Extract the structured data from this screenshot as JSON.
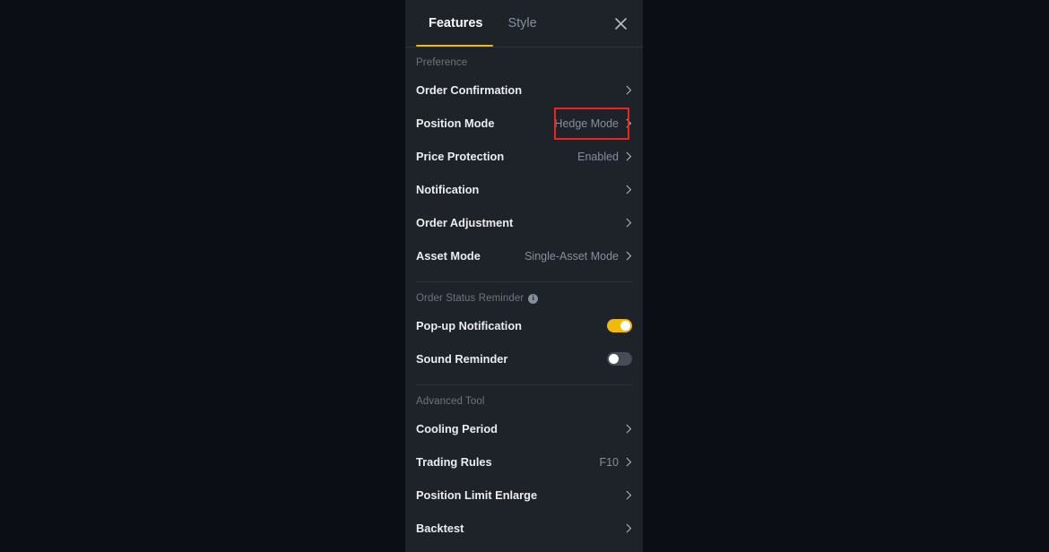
{
  "colors": {
    "page_background": "#0b0e15",
    "panel_background": "#1e2329",
    "accent": "#f0b90b",
    "divider": "#2b3139",
    "label_text": "#eaecef",
    "muted_text": "#848e9c",
    "highlight_box": "#e8271f"
  },
  "header": {
    "tabs": [
      {
        "label": "Features",
        "active": true
      },
      {
        "label": "Style",
        "active": false
      }
    ],
    "close_icon": "close-icon",
    "close_glyph": "✕"
  },
  "sections": [
    {
      "label": "Preference",
      "has_info_icon": false,
      "rows": [
        {
          "label": "Order Confirmation",
          "value": "",
          "type": "chevron"
        },
        {
          "label": "Position Mode",
          "value": "Hedge Mode",
          "type": "chevron",
          "highlighted": true
        },
        {
          "label": "Price Protection",
          "value": "Enabled",
          "type": "chevron"
        },
        {
          "label": "Notification",
          "value": "",
          "type": "chevron"
        },
        {
          "label": "Order Adjustment",
          "value": "",
          "type": "chevron"
        },
        {
          "label": "Asset Mode",
          "value": "Single-Asset Mode",
          "type": "chevron"
        }
      ]
    },
    {
      "label": "Order Status Reminder",
      "has_info_icon": true,
      "info_glyph": "i",
      "rows": [
        {
          "label": "Pop-up Notification",
          "value": "",
          "type": "toggle",
          "toggle_state": "on"
        },
        {
          "label": "Sound Reminder",
          "value": "",
          "type": "toggle",
          "toggle_state": "off"
        }
      ]
    },
    {
      "label": "Advanced Tool",
      "has_info_icon": false,
      "rows": [
        {
          "label": "Cooling Period",
          "value": "",
          "type": "chevron"
        },
        {
          "label": "Trading Rules",
          "value": "F10",
          "type": "chevron"
        },
        {
          "label": "Position Limit Enlarge",
          "value": "",
          "type": "chevron"
        },
        {
          "label": "Backtest",
          "value": "",
          "type": "chevron"
        }
      ]
    }
  ]
}
